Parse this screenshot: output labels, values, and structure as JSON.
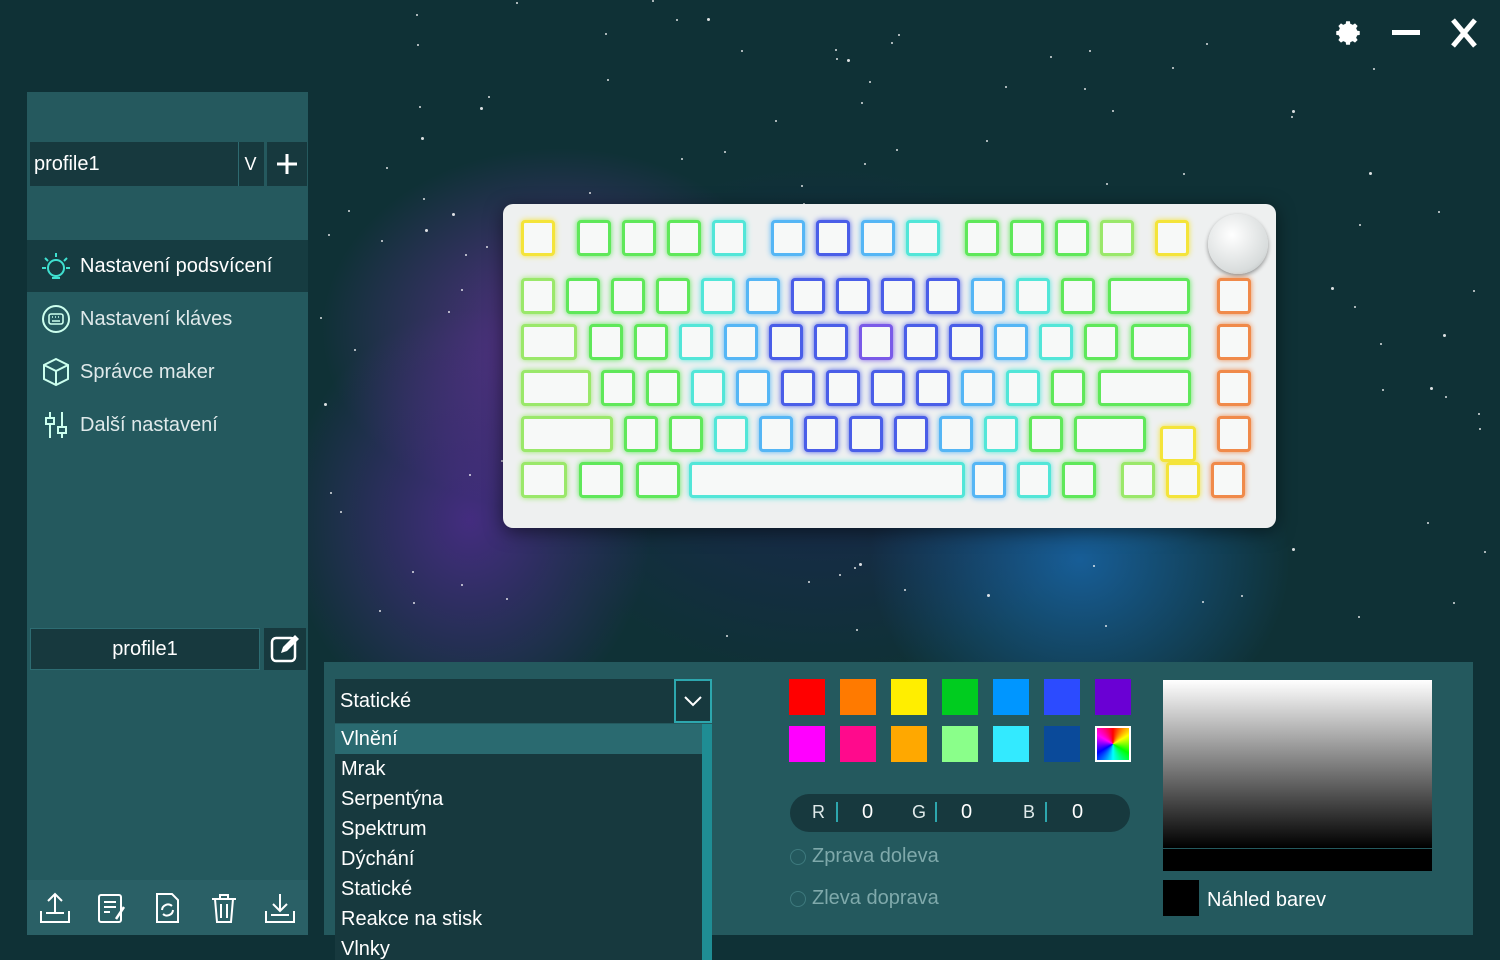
{
  "window": {
    "controls": [
      "gear-icon",
      "minimize-icon",
      "close-icon"
    ]
  },
  "sidebar": {
    "profile_select": "profile1",
    "profile_caret": "V",
    "menu": [
      {
        "label": "Nastavení podsvícení",
        "icon": "light-bulb-icon",
        "active": true
      },
      {
        "label": "Nastavení kláves",
        "icon": "keyboard-icon",
        "active": false
      },
      {
        "label": "Správce maker",
        "icon": "cube-icon",
        "active": false
      },
      {
        "label": "Další nastavení",
        "icon": "sliders-icon",
        "active": false
      }
    ],
    "profile_name": "profile1",
    "bottom_icons": [
      "export-icon",
      "notes-icon",
      "refresh-icon",
      "trash-icon",
      "import-icon"
    ]
  },
  "effect": {
    "selected": "Statické",
    "options": [
      "Vlnění",
      "Mrak",
      "Serpentýna",
      "Spektrum",
      "Dýchání",
      "Statické",
      "Reakce na stisk",
      "Vlnky"
    ],
    "highlighted": "Vlnění"
  },
  "colors": {
    "swatches": [
      "#ff0000",
      "#ff7a00",
      "#ffee00",
      "#00cc1f",
      "#0096ff",
      "#2c4bff",
      "#6a00d4",
      "#ff00ff",
      "#ff0a8c",
      "#ffa800",
      "#8aff8a",
      "#33eaff",
      "#0a4a9a",
      "rainbow"
    ],
    "rgb": {
      "r_label": "R",
      "r": "0",
      "g_label": "G",
      "g": "0",
      "b_label": "B",
      "b": "0"
    },
    "direction_options": [
      "Zprava doleva",
      "Zleva doprava"
    ],
    "preview_label": "Náhled barev",
    "preview_color": "#000000"
  }
}
